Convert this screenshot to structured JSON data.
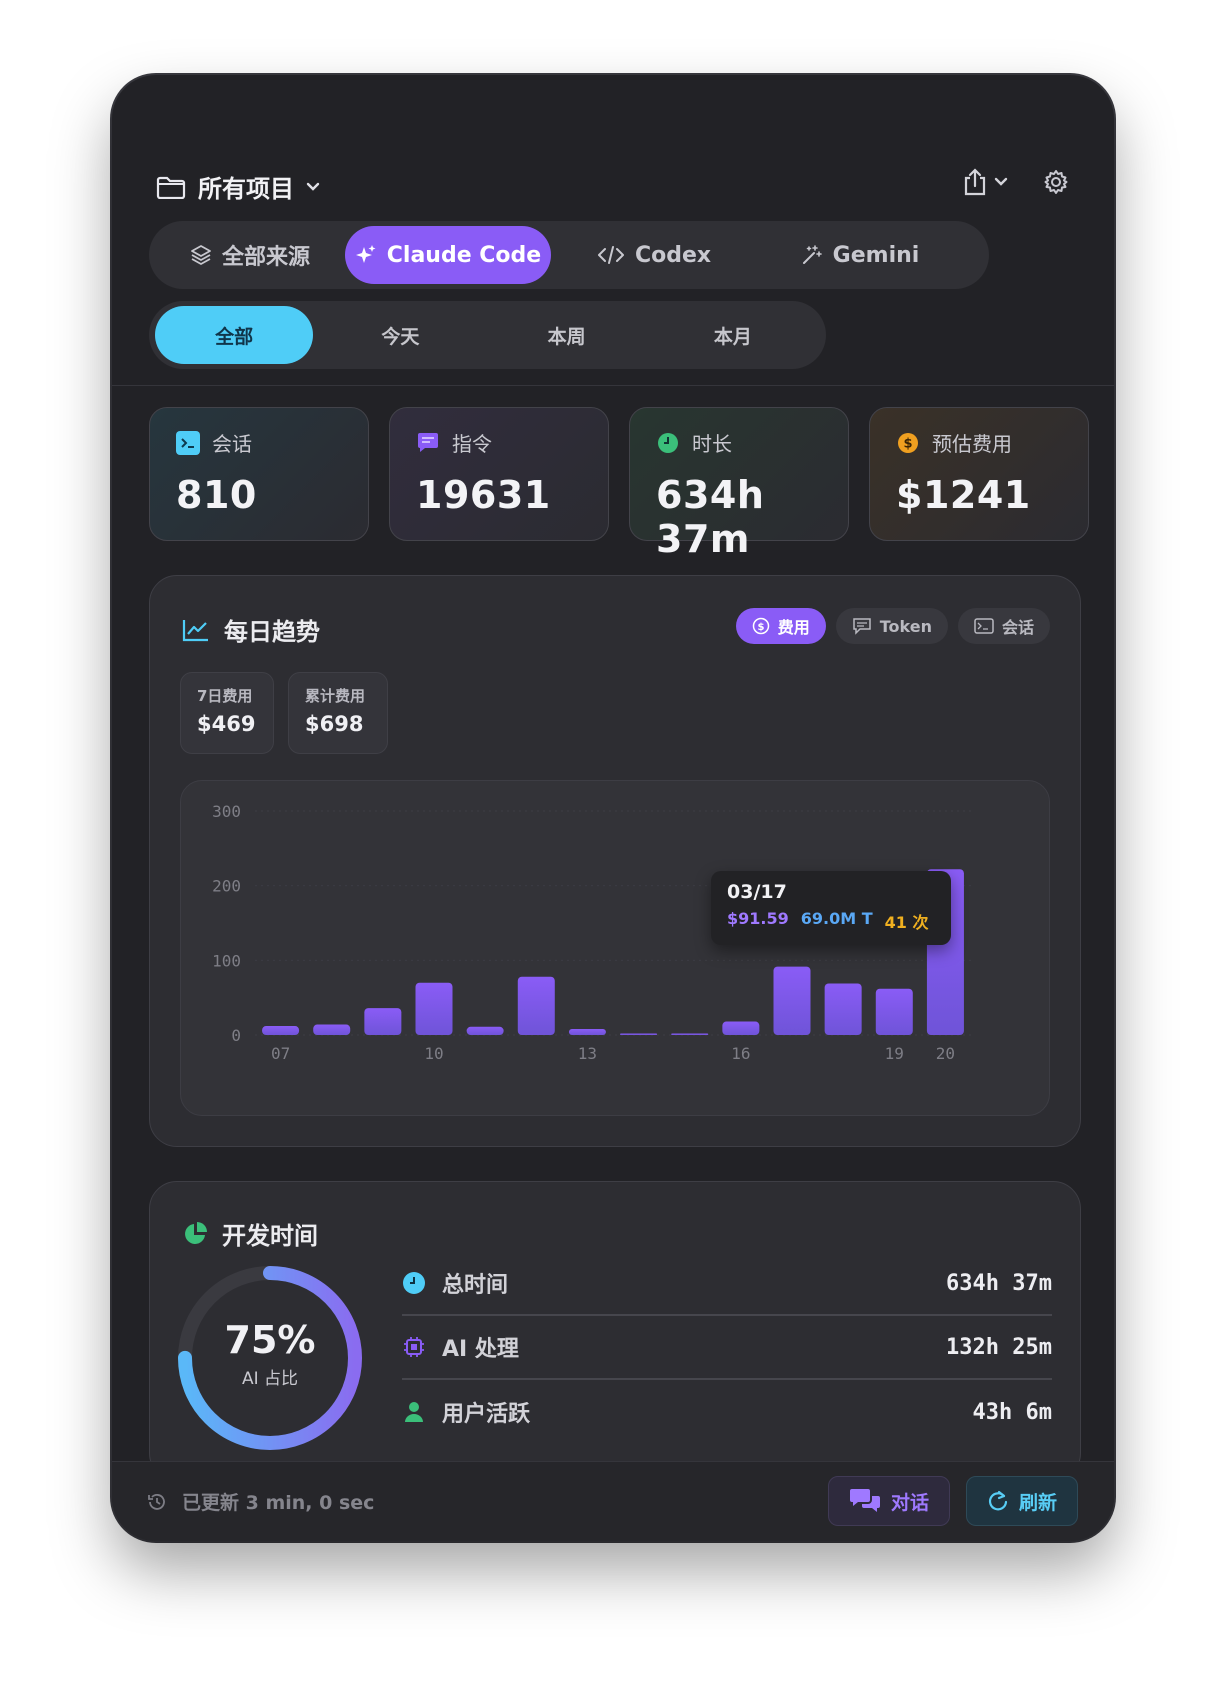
{
  "header": {
    "project_label": "所有项目"
  },
  "source_tabs": [
    {
      "label": "全部来源",
      "icon": "layers-icon",
      "active": false
    },
    {
      "label": "Claude Code",
      "icon": "sparkle-icon",
      "active": true
    },
    {
      "label": "Codex",
      "icon": "code-icon",
      "active": false
    },
    {
      "label": "Gemini",
      "icon": "magic-wand-icon",
      "active": false
    }
  ],
  "range_tabs": [
    {
      "label": "全部",
      "active": true
    },
    {
      "label": "今天",
      "active": false
    },
    {
      "label": "本周",
      "active": false
    },
    {
      "label": "本月",
      "active": false
    }
  ],
  "stats": [
    {
      "label": "会话",
      "value": "810",
      "icon": "terminal-icon",
      "color": "#4fcdf7"
    },
    {
      "label": "指令",
      "value": "19631",
      "icon": "chat-bubble-icon",
      "color": "#8a5cf6"
    },
    {
      "label": "时长",
      "value": "634h 37m",
      "icon": "clock-icon",
      "color": "#3bbf7a"
    },
    {
      "label": "预估费用",
      "value": "$1241",
      "icon": "dollar-icon",
      "color": "#f0a020"
    }
  ],
  "trend": {
    "title": "每日趋势",
    "metrics": [
      {
        "label": "费用",
        "active": true
      },
      {
        "label": "Token",
        "active": false
      },
      {
        "label": "会话",
        "active": false
      }
    ],
    "summary": [
      {
        "label": "7日费用",
        "value": "$469"
      },
      {
        "label": "累计费用",
        "value": "$698"
      }
    ],
    "tooltip": {
      "date": "03/17",
      "cost": "$91.59",
      "tokens": "69.0M T",
      "count": "41 次"
    }
  },
  "chart_data": {
    "type": "bar",
    "categories": [
      "07",
      "08",
      "09",
      "10",
      "11",
      "12",
      "13",
      "14",
      "15",
      "16",
      "17",
      "18",
      "19",
      "20"
    ],
    "x_tick_labels": [
      "07",
      "10",
      "13",
      "16",
      "19",
      "20"
    ],
    "values": [
      12,
      14,
      36,
      70,
      11,
      78,
      8,
      1,
      2,
      18,
      91.59,
      69,
      62,
      222
    ],
    "ylim": [
      0,
      300
    ],
    "y_ticks": [
      "300",
      "200",
      "100",
      "0"
    ],
    "bar_color": "#8a5cf6"
  },
  "dev_time": {
    "title": "开发时间",
    "percent": "75%",
    "percent_label": "AI 占比",
    "ring_fraction": 0.75,
    "rows": [
      {
        "label": "总时间",
        "value": "634h 37m",
        "icon": "clock-icon",
        "color": "#4fcdf7"
      },
      {
        "label": "AI 处理",
        "value": "132h 25m",
        "icon": "cpu-icon",
        "color": "#8a5cf6"
      },
      {
        "label": "用户活跃",
        "value": "43h 6m",
        "icon": "user-icon",
        "color": "#3bbf7a"
      }
    ]
  },
  "footer": {
    "updated": "已更新 3 min, 0 sec",
    "chat_label": "对话",
    "refresh_label": "刷新"
  }
}
